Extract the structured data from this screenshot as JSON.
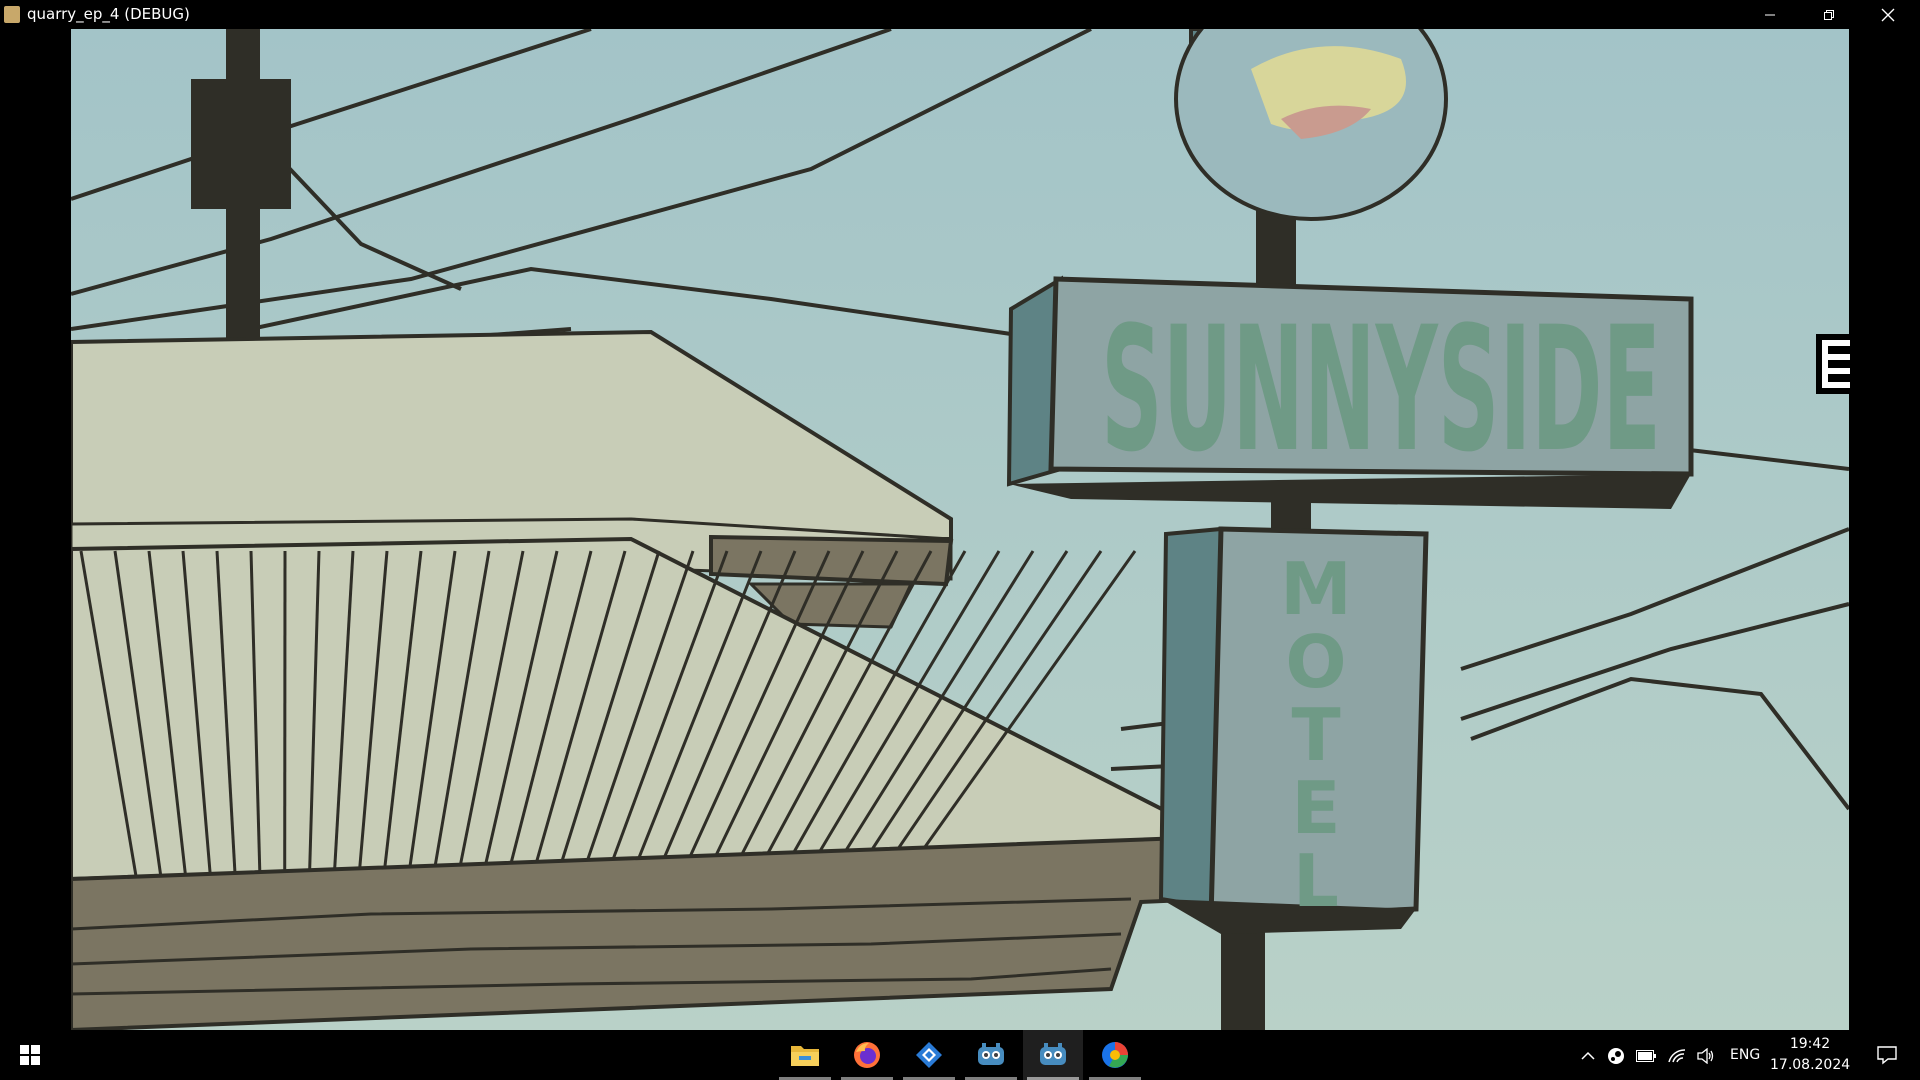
{
  "window": {
    "title": "quarry_ep_4 (DEBUG)",
    "controls": [
      "minimize-icon",
      "restore-icon",
      "close-icon"
    ]
  },
  "scene": {
    "sign_top_text": "SUNNYSIDE",
    "sign_vertical_letters": [
      "M",
      "O",
      "T",
      "E",
      "L"
    ],
    "colors": {
      "sky": "#a9c8cc",
      "roof_light": "#c8cdb7",
      "roof_lines": "#2f2e27",
      "wood": "#7b7562",
      "sign_face": "#8ea4a4",
      "sign_side": "#5e8385",
      "sign_text": "#6f9a86",
      "pole": "#2f2e27"
    }
  },
  "taskbar": {
    "start_icon": "windows-start-icon",
    "apps": [
      {
        "name": "file-explorer-icon",
        "active": false
      },
      {
        "name": "firefox-icon",
        "active": false
      },
      {
        "name": "store-app-icon",
        "active": false
      },
      {
        "name": "godot-icon",
        "active": false
      },
      {
        "name": "godot-debug-icon",
        "active": true
      },
      {
        "name": "browser-ring-icon",
        "active": false
      }
    ],
    "tray": {
      "language": "ENG",
      "time": "19:42",
      "date": "17.08.2024"
    }
  }
}
